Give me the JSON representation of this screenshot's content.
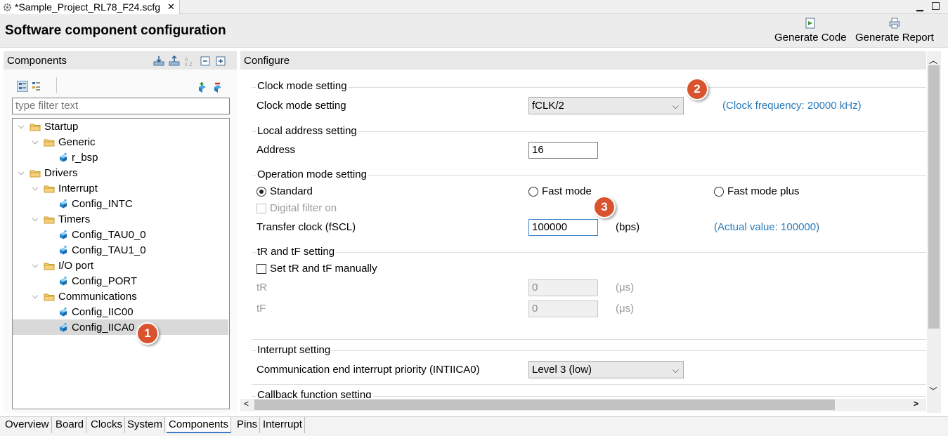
{
  "file_tab": {
    "label": "*Sample_Project_RL78_F24.scfg"
  },
  "header": {
    "title": "Software component configuration",
    "generate_code": "Generate Code",
    "generate_report": "Generate Report"
  },
  "components": {
    "title": "Components",
    "filter_placeholder": "type filter text",
    "tree": [
      {
        "label": "Startup",
        "depth": 0,
        "type": "folder"
      },
      {
        "label": "Generic",
        "depth": 1,
        "type": "folder"
      },
      {
        "label": "r_bsp",
        "depth": 2,
        "type": "component"
      },
      {
        "label": "Drivers",
        "depth": 0,
        "type": "folder"
      },
      {
        "label": "Interrupt",
        "depth": 1,
        "type": "folder"
      },
      {
        "label": "Config_INTC",
        "depth": 2,
        "type": "component"
      },
      {
        "label": "Timers",
        "depth": 1,
        "type": "folder"
      },
      {
        "label": "Config_TAU0_0",
        "depth": 2,
        "type": "component"
      },
      {
        "label": "Config_TAU1_0",
        "depth": 2,
        "type": "component"
      },
      {
        "label": "I/O port",
        "depth": 1,
        "type": "folder"
      },
      {
        "label": "Config_PORT",
        "depth": 2,
        "type": "component"
      },
      {
        "label": "Communications",
        "depth": 1,
        "type": "folder"
      },
      {
        "label": "Config_IIC00",
        "depth": 2,
        "type": "component"
      },
      {
        "label": "Config_IICA0",
        "depth": 2,
        "type": "component",
        "selected": true
      }
    ]
  },
  "configure": {
    "title": "Configure",
    "clock_group": "Clock mode setting",
    "clock_label": "Clock mode setting",
    "clock_value": "fCLK/2",
    "clock_freq": "(Clock frequency: 20000 kHz)",
    "address_group": "Local address setting",
    "address_label": "Address",
    "address_value": "16",
    "op_group": "Operation mode setting",
    "standard": "Standard",
    "fast": "Fast mode",
    "fast_plus": "Fast mode plus",
    "digital_filter": "Digital filter on",
    "transfer_label": "Transfer clock (fSCL)",
    "transfer_value": "100000",
    "transfer_unit": "(bps)",
    "actual_value": "(Actual value: 100000)",
    "trtf_group": "tR and tF setting",
    "trtf_manual": "Set tR and tF manually",
    "tr_label": "tR",
    "tr_value": "0",
    "tf_label": "tF",
    "tf_value": "0",
    "us_unit": "(μs)",
    "interrupt_group": "Interrupt setting",
    "interrupt_label": "Communication end interrupt priority (INTIICA0)",
    "interrupt_value": "Level 3 (low)",
    "callback_group": "Callback function setting"
  },
  "badges": {
    "one": "1",
    "two": "2",
    "three": "3"
  },
  "bottom_tabs": [
    "Overview",
    "Board",
    "Clocks",
    "System",
    "Components",
    "Pins",
    "Interrupt"
  ],
  "colors": {
    "accent": "#2a7ab8",
    "badge": "#d9532e",
    "selection": "#d9d9d9"
  }
}
